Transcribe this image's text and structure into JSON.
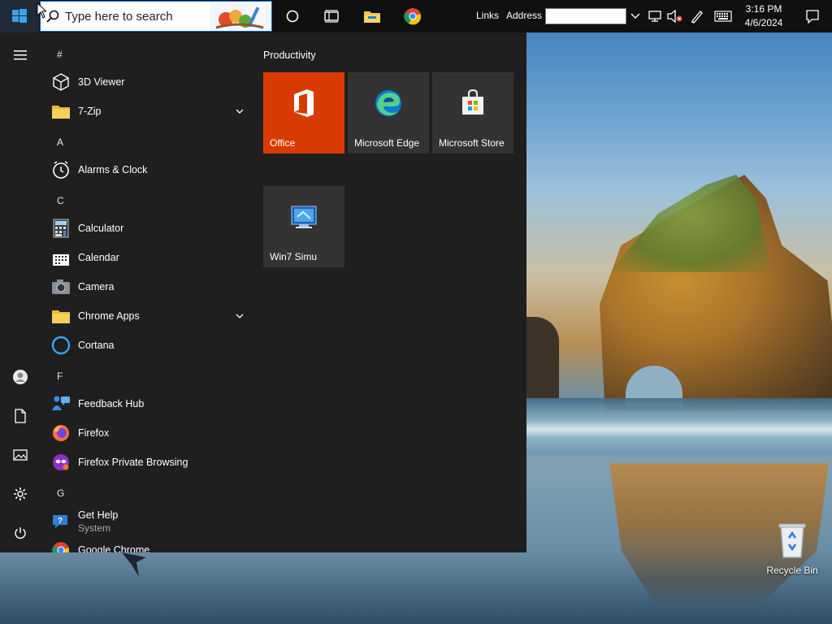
{
  "taskbar": {
    "search_placeholder": "Type here to search",
    "links_label": "Links",
    "address_label": "Address",
    "address_value": "",
    "clock_time": "3:16 PM",
    "clock_date": "4/6/2024"
  },
  "start_menu": {
    "apps": [
      {
        "type": "letter",
        "text": "#"
      },
      {
        "type": "app",
        "label": "3D Viewer",
        "icon": "cube-icon"
      },
      {
        "type": "app",
        "label": "7-Zip",
        "icon": "folder-icon",
        "expandable": true
      },
      {
        "type": "letter",
        "text": "A"
      },
      {
        "type": "app",
        "label": "Alarms & Clock",
        "icon": "clock-icon"
      },
      {
        "type": "letter",
        "text": "C"
      },
      {
        "type": "app",
        "label": "Calculator",
        "icon": "calculator-icon"
      },
      {
        "type": "app",
        "label": "Calendar",
        "icon": "calendar-icon"
      },
      {
        "type": "app",
        "label": "Camera",
        "icon": "camera-icon"
      },
      {
        "type": "app",
        "label": "Chrome Apps",
        "icon": "folder-icon",
        "expandable": true
      },
      {
        "type": "app",
        "label": "Cortana",
        "icon": "cortana-icon"
      },
      {
        "type": "letter",
        "text": "F"
      },
      {
        "type": "app",
        "label": "Feedback Hub",
        "icon": "feedback-icon"
      },
      {
        "type": "app",
        "label": "Firefox",
        "icon": "firefox-icon"
      },
      {
        "type": "app",
        "label": "Firefox Private Browsing",
        "icon": "firefox-private-icon"
      },
      {
        "type": "letter",
        "text": "G"
      },
      {
        "type": "app",
        "label": "Get Help",
        "sublabel": "System",
        "icon": "help-icon"
      },
      {
        "type": "app",
        "label": "Google Chrome",
        "icon": "chrome-icon"
      }
    ],
    "group_title": "Productivity",
    "tiles": [
      {
        "label": "Office",
        "icon": "office-icon",
        "color": "#d83b01"
      },
      {
        "label": "Microsoft Edge",
        "icon": "edge-icon",
        "color": "#333333"
      },
      {
        "label": "Microsoft Store",
        "icon": "store-icon",
        "color": "#333333"
      },
      {
        "label": "Win7 Simu",
        "icon": "win7-simu-icon",
        "color": "#333333"
      }
    ]
  },
  "desktop": {
    "recycle_bin_label": "Recycle Bin"
  }
}
